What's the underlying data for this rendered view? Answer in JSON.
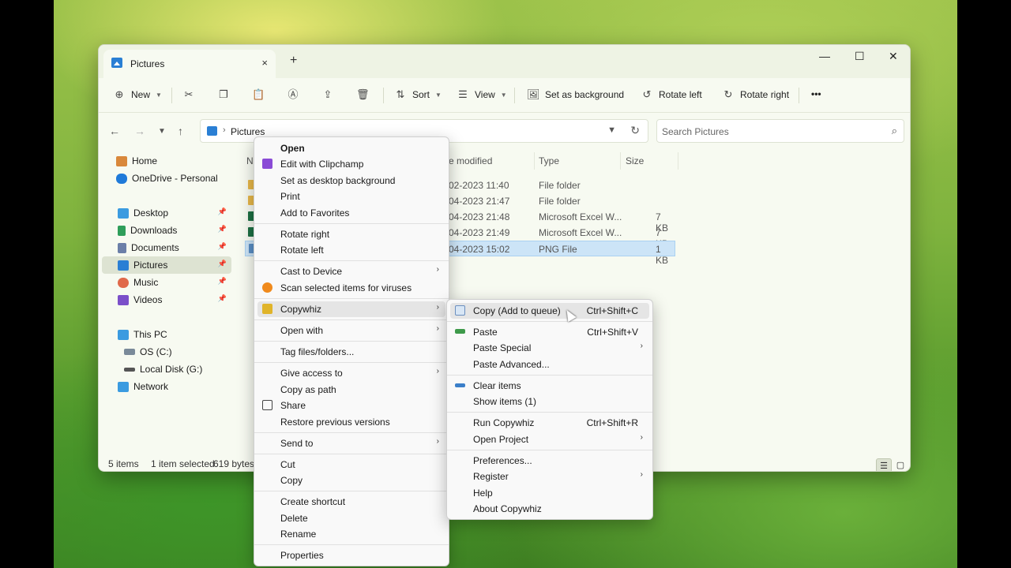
{
  "window": {
    "tab_title": "Pictures",
    "tab_close": "×",
    "new_tab": "+",
    "minimize": "—",
    "maximize": "☐",
    "close": "✕"
  },
  "toolbar": {
    "new": "New",
    "sort": "Sort",
    "view": "View",
    "set_background": "Set as background",
    "rotate_left": "Rotate left",
    "rotate_right": "Rotate right",
    "more": "•••"
  },
  "address": {
    "path": "Pictures",
    "search_placeholder": "Search Pictures"
  },
  "navpane": {
    "items": [
      {
        "label": "Home",
        "color": "#d9883b",
        "pinned": false
      },
      {
        "label": "OneDrive - Personal",
        "color": "#1f7ad9",
        "pinned": false
      },
      {
        "label": "Desktop",
        "color": "#3b9be0",
        "pinned": true
      },
      {
        "label": "Downloads",
        "color": "#2e9e5a",
        "pinned": true
      },
      {
        "label": "Documents",
        "color": "#6b7fa8",
        "pinned": true
      },
      {
        "label": "Pictures",
        "color": "#2a7fd4",
        "pinned": true
      },
      {
        "label": "Music",
        "color": "#e0694a",
        "pinned": true
      },
      {
        "label": "Videos",
        "color": "#7b4fc9",
        "pinned": true
      },
      {
        "label": "This PC",
        "color": "#3b9be0",
        "pinned": false
      },
      {
        "label": "OS (C:)",
        "color": "#7a8a99",
        "pinned": false
      },
      {
        "label": "Local Disk (G:)",
        "color": "#555555",
        "pinned": false
      },
      {
        "label": "Network",
        "color": "#3b9be0",
        "pinned": false
      }
    ],
    "pin_glyph": "📌"
  },
  "columns": {
    "name": "Na",
    "date": "e modified",
    "type": "Type",
    "size": "Size"
  },
  "files": [
    {
      "date": "02-2023 11:40",
      "type": "File folder",
      "size": ""
    },
    {
      "date": "04-2023 21:47",
      "type": "File folder",
      "size": ""
    },
    {
      "date": "04-2023 21:48",
      "type": "Microsoft Excel W...",
      "size": "7 KB"
    },
    {
      "date": "04-2023 21:49",
      "type": "Microsoft Excel W...",
      "size": "7 KB"
    },
    {
      "date": "04-2023 15:02",
      "type": "PNG File",
      "size": "1 KB"
    }
  ],
  "status": {
    "items": "5 items",
    "selected": "1 item selected",
    "size": "619 bytes"
  },
  "context_menu": {
    "open": "Open",
    "edit_clipchamp": "Edit with Clipchamp",
    "set_desktop_bg": "Set as desktop background",
    "print": "Print",
    "add_favorites": "Add to Favorites",
    "rotate_right": "Rotate right",
    "rotate_left": "Rotate left",
    "cast": "Cast to Device",
    "scan": "Scan selected items for viruses",
    "copywhiz": "Copywhiz",
    "open_with": "Open with",
    "tag": "Tag files/folders...",
    "give_access": "Give access to",
    "copy_path": "Copy as path",
    "share": "Share",
    "restore": "Restore previous versions",
    "send_to": "Send to",
    "cut": "Cut",
    "copy": "Copy",
    "create_shortcut": "Create shortcut",
    "delete": "Delete",
    "rename": "Rename",
    "properties": "Properties"
  },
  "submenu": {
    "copy_queue": "Copy (Add to queue)",
    "copy_queue_sc": "Ctrl+Shift+C",
    "paste": "Paste",
    "paste_sc": "Ctrl+Shift+V",
    "paste_special": "Paste Special",
    "paste_advanced": "Paste Advanced...",
    "clear_items": "Clear items",
    "show_items": "Show items (1)",
    "run_copywhiz": "Run Copywhiz",
    "run_sc": "Ctrl+Shift+R",
    "open_project": "Open Project",
    "preferences": "Preferences...",
    "register": "Register",
    "help": "Help",
    "about": "About Copywhiz"
  }
}
